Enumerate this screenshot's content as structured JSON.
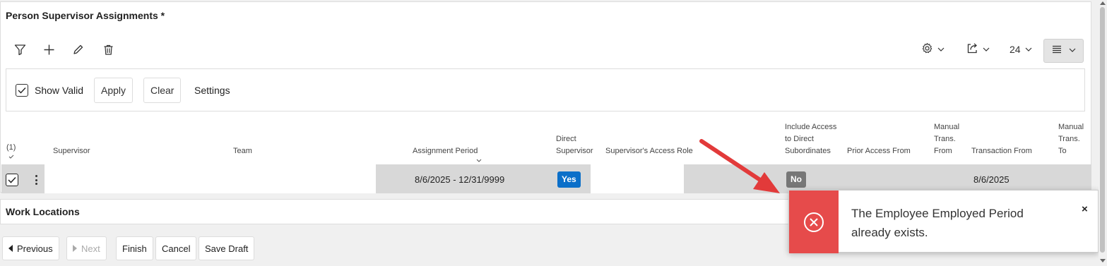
{
  "panel": {
    "title": "Person Supervisor Assignments *"
  },
  "toolbar": {
    "filter_icon": "filter-icon",
    "add_icon": "plus-icon",
    "edit_icon": "pencil-icon",
    "delete_icon": "trash-icon",
    "page_size": "24"
  },
  "filter_bar": {
    "show_valid_label": "Show Valid",
    "apply_label": "Apply",
    "clear_label": "Clear",
    "settings_label": "Settings"
  },
  "table": {
    "selected_count": "(1)",
    "headers": {
      "supervisor": "Supervisor",
      "team": "Team",
      "assignment_period": "Assignment Period",
      "direct_supervisor_1": "Direct",
      "direct_supervisor_2": "Supervisor",
      "access_role": "Supervisor's Access Role",
      "include_access_1": "Include Access",
      "include_access_2": "to Direct",
      "include_access_3": "Subordinates",
      "prior_access_from": "Prior Access From",
      "manual_from_1": "Manual",
      "manual_from_2": "Trans.",
      "manual_from_3": "From",
      "transaction_from": "Transaction From",
      "manual_to_1": "Manual",
      "manual_to_2": "Trans.",
      "manual_to_3": "To"
    },
    "row": {
      "assignment_period": "8/6/2025 - 12/31/9999",
      "direct_supervisor": "Yes",
      "include_access": "No",
      "transaction_from": "8/6/2025"
    }
  },
  "section2": {
    "title": "Work Locations"
  },
  "nav": {
    "previous": "Previous",
    "next": "Next",
    "finish": "Finish",
    "cancel": "Cancel",
    "save_draft": "Save Draft"
  },
  "toast": {
    "message": "The Employee Employed Period already exists.",
    "close": "×"
  },
  "colors": {
    "yes_badge": "#0b6fc9",
    "no_badge": "#777777",
    "error": "#e64b4b",
    "arrow": "#e23a3a"
  }
}
